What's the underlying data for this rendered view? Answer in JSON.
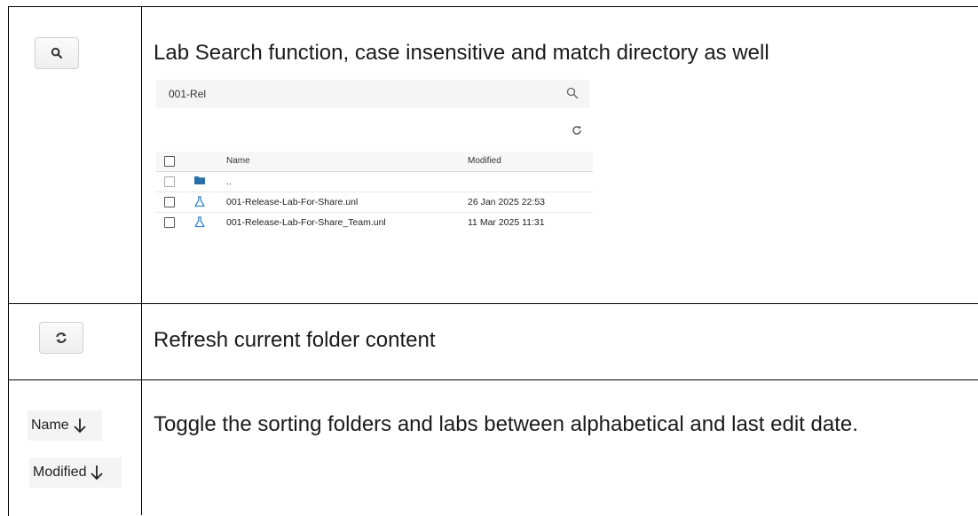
{
  "rows": [
    {
      "icon": "search-icon",
      "description": "Lab Search function, case insensitive and match directory as well"
    },
    {
      "icon": "refresh-icon",
      "description": "Refresh current folder content"
    },
    {
      "description": "Toggle the sorting folders and labs between alphabetical and last edit date.",
      "sort_buttons": [
        {
          "label": "Name",
          "icon": "arrow-down-icon"
        },
        {
          "label": "Modified",
          "icon": "arrow-down-icon"
        }
      ]
    }
  ],
  "browser": {
    "search_value": "001-Rel",
    "columns": [
      "Name",
      "Modified"
    ],
    "entries": [
      {
        "type": "folder",
        "name": "..",
        "modified": ""
      },
      {
        "type": "lab",
        "name": "001-Release-Lab-For-Share.unl",
        "modified": "26 Jan 2025 22:53"
      },
      {
        "type": "lab",
        "name": "001-Release-Lab-For-Share_Team.unl",
        "modified": "11 Mar 2025 11:31"
      }
    ]
  },
  "colors": {
    "folder": "#2c6fa8",
    "lab_flask": "#3a86c8",
    "border": "#000000"
  }
}
